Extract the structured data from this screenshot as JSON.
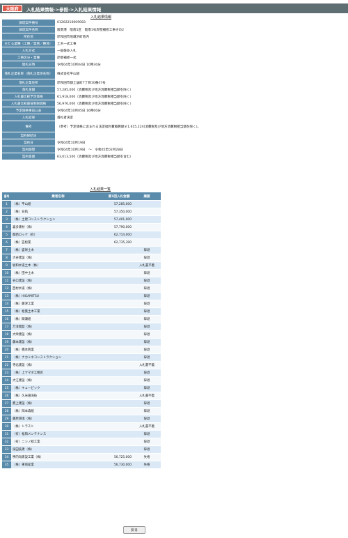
{
  "header": {
    "prefecture": "大阪府",
    "breadcrumb": "入札結果情報->参照->入札結果情報"
  },
  "info_title": "入札結果情報",
  "info_rows": [
    {
      "label": "調達案件番号",
      "value": "01202210009083"
    },
    {
      "label": "調達案件名称",
      "value": "阪南港　阪南1区　阪南1号岸壁補修工事その2"
    },
    {
      "label": "所在地",
      "value": "岸和田市地蔵浜町地内"
    },
    {
      "label": "主たる業種（工種／業務／種目）",
      "value": "土木一式工事"
    },
    {
      "label": "入札方式",
      "value": "一般競争入札"
    },
    {
      "label": "工事区分・業種",
      "value": "岸壁補修一式"
    },
    {
      "label": "開札日時",
      "value": "令和04年10月04日 10時30分"
    },
    {
      "label": "落札企業名称（落札企業体名称）",
      "value": "株式会社平山組",
      "tall": true
    },
    {
      "label": "落札企業住所",
      "value": "岸和田市額土居町7丁目10番47号"
    },
    {
      "label": "落札金額",
      "value": "57,285,000（消費税及び地方消費税相当額を除く）"
    },
    {
      "label": "入札書比較予定価格",
      "value": "61,918,000（消費税及び地方消費税相当額を除く）"
    },
    {
      "label": "入札書比較最低制限価格",
      "value": "56,976,000（消費税及び地方消費税相当額を除く）"
    },
    {
      "label": "予定価格事前公表",
      "value": "令和04年10月05日 16時00分"
    },
    {
      "label": "入札結果",
      "value": "落札者決定"
    },
    {
      "label": "備考",
      "value": "（参考）予定価格に含まれる法定福利費概算額￥1,615,224(消費税及び地方消費税相当額を除く)。",
      "tall": true
    },
    {
      "label": "契約締結日",
      "value": ""
    },
    {
      "label": "契約日",
      "value": "令和04年10月19日"
    },
    {
      "label": "契約期間",
      "value": "令和04年10月19日　～　令和05年02月28日"
    },
    {
      "label": "契約金額",
      "value": "63,013,500（消費税及び地方消費税相当額を含む）"
    }
  ],
  "bid_title": "入札結果一覧",
  "bid_headers": {
    "no": "番号",
    "name": "業者名称",
    "price": "第1回入札金額",
    "remark": "摘要"
  },
  "bids": [
    {
      "name": "（株）平山組",
      "price": "57,285,000",
      "remark": ""
    },
    {
      "name": "（株）日航",
      "price": "57,350,000",
      "remark": ""
    },
    {
      "name": "（株）土建コンストラクション",
      "price": "57,401,000",
      "remark": ""
    },
    {
      "name": "喜多建材（株）",
      "price": "57,790,000",
      "remark": ""
    },
    {
      "name": "関西ロック（有）",
      "price": "62,714,000",
      "remark": ""
    },
    {
      "name": "（株）笠松業",
      "price": "62,735,390",
      "remark": ""
    },
    {
      "name": "（株）盛栄土木",
      "price": "",
      "remark": "辞退"
    },
    {
      "name": "大谷建設（株）",
      "price": "",
      "remark": "辞退"
    },
    {
      "name": "坂和水道土木（株）",
      "price": "",
      "remark": "入札書不着"
    },
    {
      "name": "（株）田中土木",
      "price": "",
      "remark": "辞退"
    },
    {
      "name": "谷口建設（株）",
      "price": "",
      "remark": "辞退"
    },
    {
      "name": "西村水道（株）",
      "price": "",
      "remark": "辞退"
    },
    {
      "name": "（株）HIGAMITSU",
      "price": "",
      "remark": "辞退"
    },
    {
      "name": "（株）藤津工業",
      "price": "",
      "remark": "辞退"
    },
    {
      "name": "（株）松葉土木工業",
      "price": "",
      "remark": "辞退"
    },
    {
      "name": "（株）間瀬組",
      "price": "",
      "remark": "辞退"
    },
    {
      "name": "万洋開発（株）",
      "price": "",
      "remark": "辞退"
    },
    {
      "name": "大栄建設（株）",
      "price": "",
      "remark": "辞退"
    },
    {
      "name": "藤本建設（株）",
      "price": "",
      "remark": "辞退"
    },
    {
      "name": "（株）橋本興業",
      "price": "",
      "remark": "辞退"
    },
    {
      "name": "（株）ナカミネコンストラクション",
      "price": "",
      "remark": "辞退"
    },
    {
      "name": "寺北建設（株）",
      "price": "",
      "remark": "入札書不着"
    },
    {
      "name": "（株）上ヤマダ工務店",
      "price": "",
      "remark": "辞退"
    },
    {
      "name": "大江建設（株）",
      "price": "",
      "remark": "辞退"
    },
    {
      "name": "（株）キューピック",
      "price": "",
      "remark": "辞退"
    },
    {
      "name": "（株）久米田海技",
      "price": "",
      "remark": "入札書不着"
    },
    {
      "name": "鷹上建設（株）",
      "price": "",
      "remark": "辞退"
    },
    {
      "name": "（株）岡本森組",
      "price": "",
      "remark": "辞退"
    },
    {
      "name": "藤原環境（株）",
      "price": "",
      "remark": "辞退"
    },
    {
      "name": "（株）トラスト",
      "price": "",
      "remark": "入札書不着"
    },
    {
      "name": "（有）松和メンテナンス",
      "price": "",
      "remark": "辞退"
    },
    {
      "name": "（有）ニシノ総工業",
      "price": "",
      "remark": "辞退"
    },
    {
      "name": "泉田技建（株）",
      "price": "",
      "remark": "辞退"
    },
    {
      "name": "堺内海建設工業（株）",
      "price": "56,725,000",
      "remark": "失格"
    },
    {
      "name": "（株）東南産業",
      "price": "56,730,000",
      "remark": "失格"
    }
  ],
  "back_button": "戻る",
  "colors": {
    "header_bar": "#5e6e72",
    "label_bg": "#5a8bab",
    "badge_bg": "#e05a4c",
    "row_odd": "#dbe9f6",
    "row_even": "#f4f8fb"
  }
}
